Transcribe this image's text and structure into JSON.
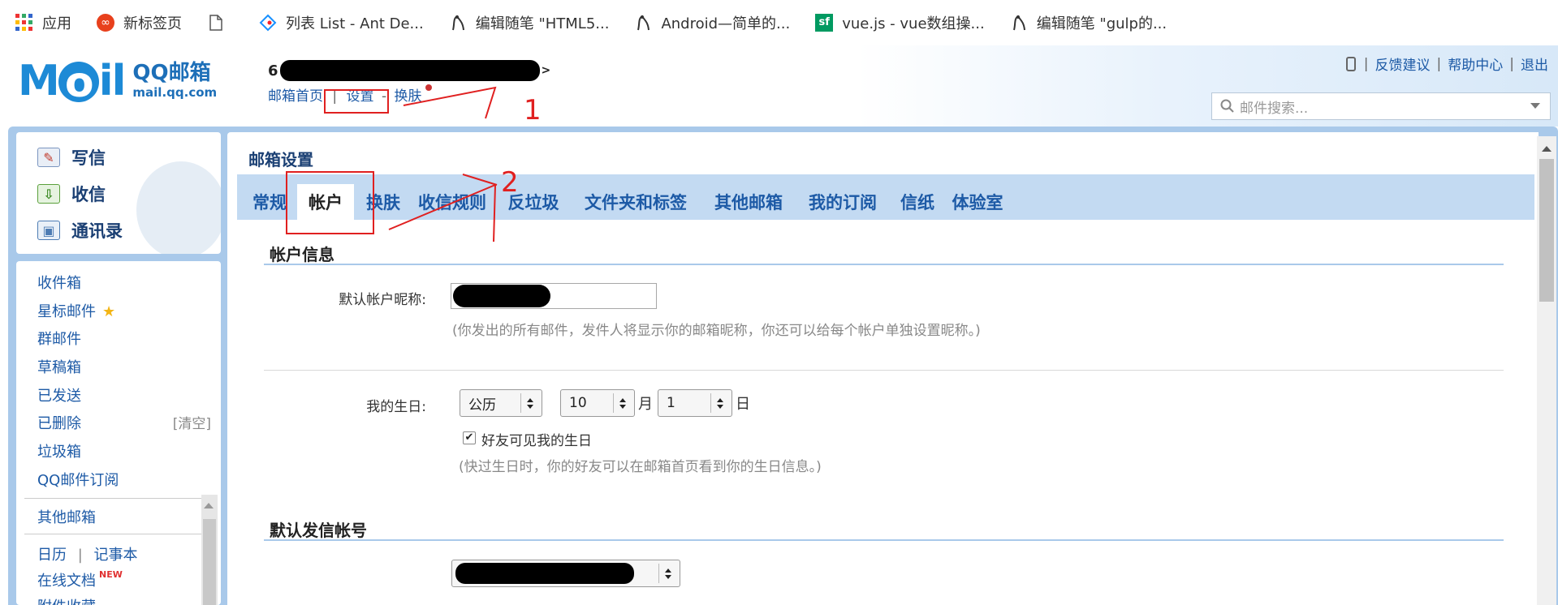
{
  "bookmarks": [
    {
      "label": "应用",
      "icon": "apps-grid-icon"
    },
    {
      "label": "新标签页",
      "icon": "infinity-icon"
    },
    {
      "label": "",
      "icon": "page-icon"
    },
    {
      "label": "列表 List - Ant De...",
      "icon": "ant-design-icon"
    },
    {
      "label": "编辑随笔 \"HTML5...",
      "icon": "cnblogs-icon"
    },
    {
      "label": "Android—简单的...",
      "icon": "cnblogs-icon"
    },
    {
      "label": "vue.js - vue数组操...",
      "icon": "segmentfault-icon"
    },
    {
      "label": "编辑随笔 \"gulp的...",
      "icon": "cnblogs-icon"
    }
  ],
  "header": {
    "logo_title": "QQ邮箱",
    "logo_domain": "mail.qq.com",
    "account_prefix": "6",
    "links": {
      "home": "邮箱首页",
      "sep": "|",
      "settings": "设置",
      "dash": "-",
      "skin": "换肤"
    },
    "top_links": [
      "反馈建议",
      "帮助中心",
      "退出"
    ],
    "top_sep": "|",
    "search_placeholder": "邮件搜索..."
  },
  "quick_actions": [
    {
      "label": "写信",
      "icon": "compose-icon"
    },
    {
      "label": "收信",
      "icon": "inbox-download-icon"
    },
    {
      "label": "通讯录",
      "icon": "contacts-icon"
    }
  ],
  "folders": {
    "items": [
      "收件箱",
      "星标邮件",
      "群邮件",
      "草稿箱",
      "已发送",
      "已删除",
      "垃圾箱",
      "QQ邮件订阅"
    ],
    "clear_link": "[清空]",
    "other_mailbox": "其他邮箱",
    "calendar": "日历",
    "calendar_sep": "|",
    "notebook": "记事本",
    "online_docs": "在线文档",
    "new_badge": "NEW",
    "attachment_collection": "附件收藏"
  },
  "settings": {
    "title": "邮箱设置",
    "tabs": [
      "常规",
      "帐户",
      "换肤",
      "收信规则",
      "反垃圾",
      "文件夹和标签",
      "其他邮箱",
      "我的订阅",
      "信纸",
      "体验室"
    ],
    "active_tab": "帐户",
    "account_info": {
      "heading": "帐户信息",
      "nickname_label": "默认帐户昵称:",
      "nickname_hint": "(你发出的所有邮件，发件人将显示你的邮箱昵称，你还可以给每个帐户单独设置昵称。)",
      "birthday_label": "我的生日:",
      "calendar_type": "公历",
      "month": "10",
      "month_unit": "月",
      "day": "1",
      "day_unit": "日",
      "friends_visible_label": "好友可见我的生日",
      "friends_visible_checked": true,
      "birthday_hint": "(快过生日时，你的好友可以在邮箱首页看到你的生日信息。)"
    },
    "default_sender": {
      "heading": "默认发信帐号"
    }
  },
  "annotations": [
    "1",
    "2"
  ],
  "colors": {
    "accent": "#1d5aa6",
    "frame": "#a9c9ea",
    "tabbar": "#c3daf2",
    "annotation": "#e02020"
  }
}
